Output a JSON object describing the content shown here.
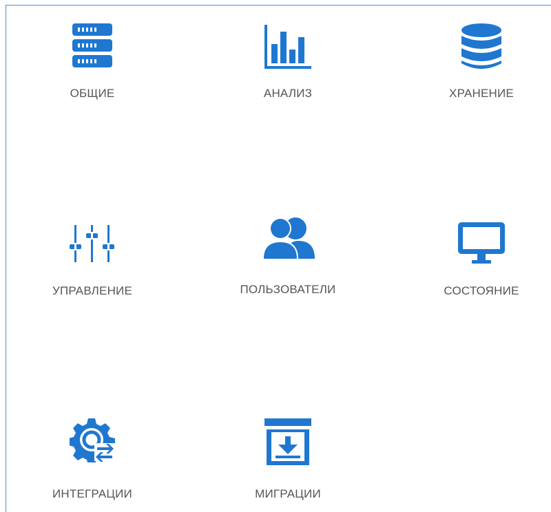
{
  "colors": {
    "accent": "#1f77d0",
    "label": "#555555",
    "frame_border": "#4d8fd6"
  },
  "tiles": [
    {
      "label": "ОБЩИЕ",
      "icon": "server-rack-icon"
    },
    {
      "label": "АНАЛИЗ",
      "icon": "bar-chart-icon"
    },
    {
      "label": "ХРАНЕНИЕ",
      "icon": "database-icon"
    },
    {
      "label": "УПРАВЛЕНИЕ",
      "icon": "sliders-icon"
    },
    {
      "label": "ПОЛЬЗОВАТЕЛИ",
      "icon": "users-icon"
    },
    {
      "label": "СОСТОЯНИЕ",
      "icon": "monitor-icon"
    },
    {
      "label": "ИНТЕГРАЦИИ",
      "icon": "gear-sync-icon"
    },
    {
      "label": "МИГРАЦИИ",
      "icon": "archive-download-icon"
    }
  ]
}
